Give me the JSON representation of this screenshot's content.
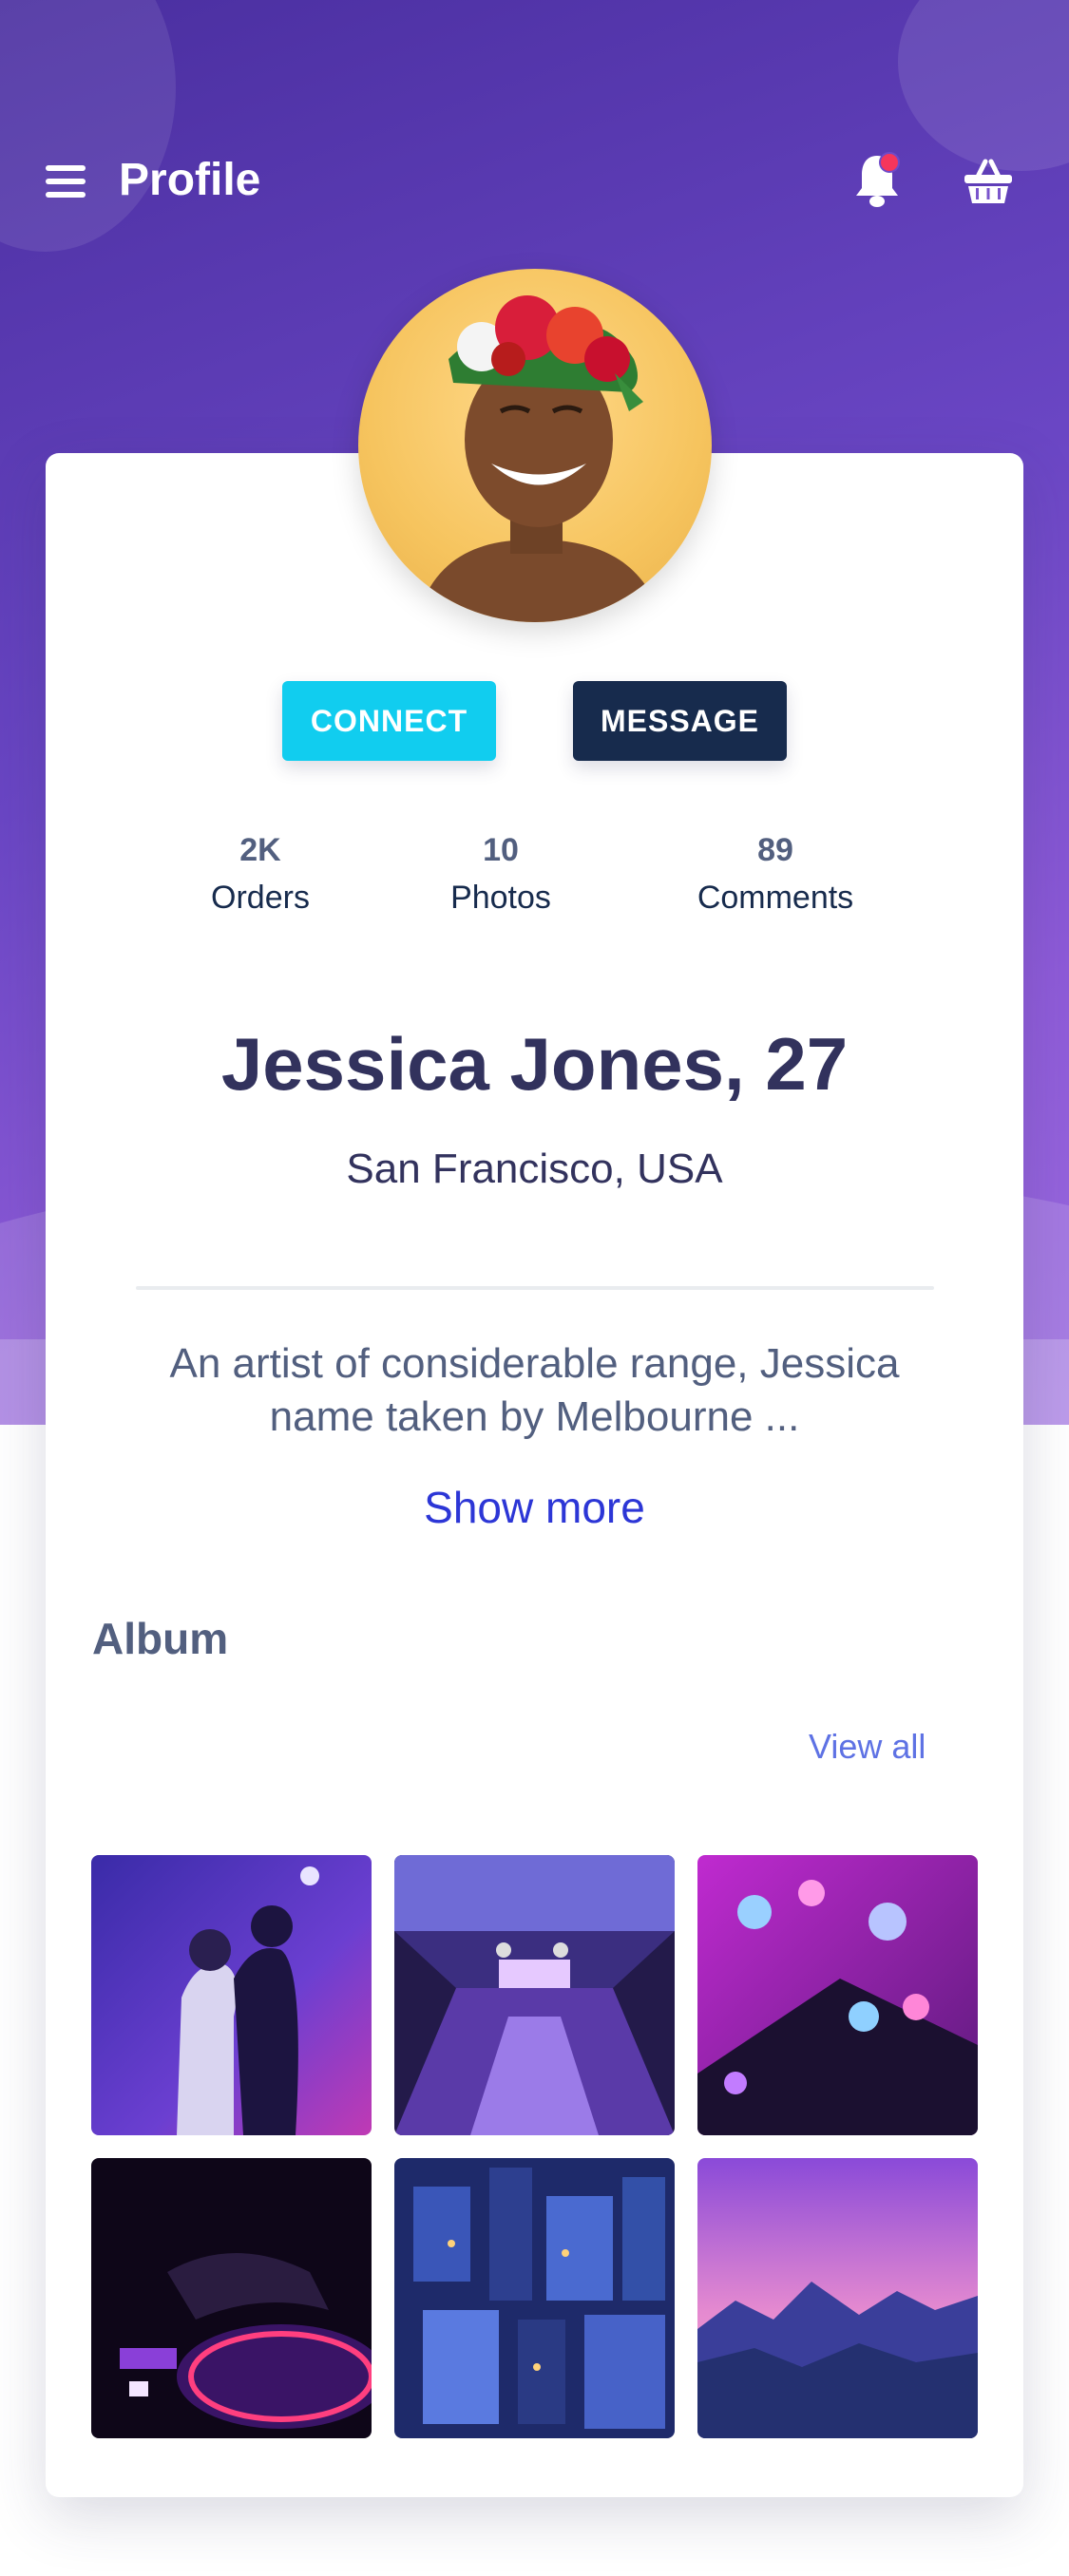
{
  "header": {
    "title": "Profile",
    "icons": [
      "menu-icon",
      "bell-icon",
      "basket-icon"
    ],
    "notification_dot_color": "#f5365c"
  },
  "profile": {
    "connect_label": "CONNECT",
    "message_label": "MESSAGE",
    "stats": [
      {
        "value": "2K",
        "label": "Orders"
      },
      {
        "value": "10",
        "label": "Photos"
      },
      {
        "value": "89",
        "label": "Comments"
      }
    ],
    "name": "Jessica Jones, 27",
    "location": "San Francisco, USA",
    "bio_line1": "An artist of considerable range, Jessica",
    "bio_line2": "name taken by Melbourne ...",
    "show_more": "Show more"
  },
  "album": {
    "title": "Album",
    "view_all": "View all"
  },
  "colors": {
    "connect": "#11cdef",
    "message": "#172b4d",
    "link": "#2c36d6",
    "hero_start": "#4a2fa0",
    "hero_end": "#9b6be0"
  }
}
